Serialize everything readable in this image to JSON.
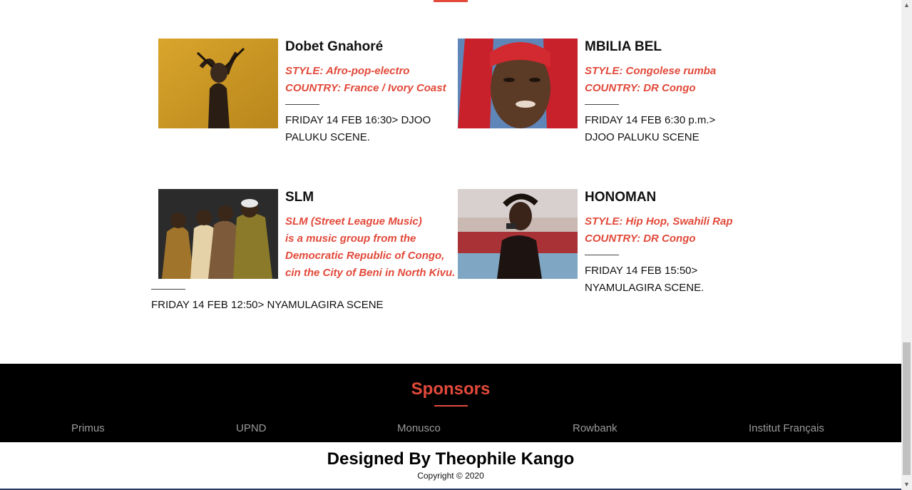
{
  "artists": [
    {
      "name": "Dobet Gnahoré",
      "meta_lines": [
        "STYLE: Afro-pop-electro",
        "COUNTRY: France / Ivory Coast"
      ],
      "schedule_lines": [
        "FRIDAY 14 FEB 16:30> DJOO",
        "PALUKU SCENE."
      ]
    },
    {
      "name": "MBILIA BEL",
      "meta_lines": [
        "STYLE: Congolese rumba",
        "COUNTRY: DR Congo"
      ],
      "schedule_lines": [
        "FRIDAY 14 FEB 6:30 p.m.>",
        "DJOO PALUKU SCENE"
      ]
    },
    {
      "name": "SLM",
      "meta_lines": [
        "SLM (Street League Music)",
        "is a music group from the",
        "Democratic Republic of Congo,",
        "cin the City of Beni in North Kivu."
      ],
      "schedule_lines": [
        "FRIDAY 14 FEB 12:50> NYAMULAGIRA SCENE"
      ]
    },
    {
      "name": "HONOMAN",
      "meta_lines": [
        "STYLE: Hip Hop, Swahili Rap",
        "COUNTRY: DR Congo"
      ],
      "schedule_lines": [
        "FRIDAY 14 FEB 15:50>",
        "NYAMULAGIRA SCENE."
      ]
    }
  ],
  "sponsors": {
    "title": "Sponsors",
    "items": [
      "Primus",
      "UPND",
      "Monusco",
      "Rowbank",
      "Institut Français"
    ]
  },
  "footer": {
    "credit": "Designed By Theophile Kango",
    "copyright": "Copyright © 2020"
  },
  "colors": {
    "accent": "#e2493a",
    "footer_bg": "#000000"
  }
}
